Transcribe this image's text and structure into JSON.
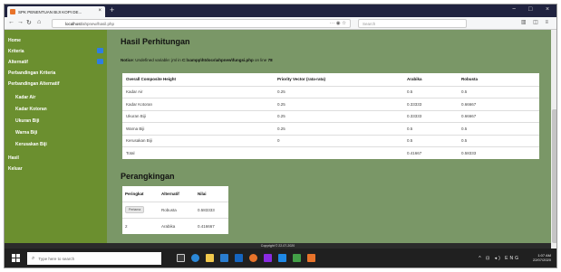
{
  "browser": {
    "tab_title": "SPK PENENTUAN BIJI KOPI DE...",
    "url_host": "localhost",
    "url_path": "/ahpnew/hasil.php",
    "search_placeholder": "Search",
    "url_extra": "··· ◉ ☆"
  },
  "sidebar": {
    "items": [
      {
        "label": "Home"
      },
      {
        "label": "Kriteria"
      },
      {
        "label": "Alternatif"
      },
      {
        "label": "Perbandingan Kriteria"
      },
      {
        "label": "Perbandingan Alternatif"
      },
      {
        "label": "Kadar Air"
      },
      {
        "label": "Kadar Kotoran"
      },
      {
        "label": "Ukuran Biji"
      },
      {
        "label": "Warna Biji"
      },
      {
        "label": "Kerusakan Biji"
      },
      {
        "label": "Hasil"
      },
      {
        "label": "Keluar"
      }
    ]
  },
  "main": {
    "title": "Hasil Perhitungan",
    "notice": {
      "label": "Notice",
      "text": ": Undefined variable: jml in ",
      "path": "C:\\xampp\\htdocs\\ahpnew\\fungsi.php",
      "line_text": " on line ",
      "line": "78"
    },
    "table": {
      "headers": [
        "Overall Composite Height",
        "Priority Vector (rata-rata)",
        "Arabika",
        "Robusta"
      ],
      "rows": [
        [
          "Kadar Air",
          "0.25",
          "0.5",
          "0.5"
        ],
        [
          "Kadar Kotoran",
          "0.25",
          "0.33333",
          "0.66667"
        ],
        [
          "Ukuran Biji",
          "0.25",
          "0.33333",
          "0.66667"
        ],
        [
          "Warna Biji",
          "0.25",
          "0.5",
          "0.5"
        ],
        [
          "Kerusakan Biji",
          "0",
          "0.5",
          "0.5"
        ],
        [
          "Total",
          "",
          "0.41667",
          "0.58333"
        ]
      ]
    },
    "ranking_title": "Perangkingan",
    "ranking": {
      "headers": [
        "Peringkat",
        "Alternatif",
        "Nilai"
      ],
      "rows": [
        [
          "Pertama",
          "Robusta",
          "0.583333"
        ],
        [
          "2",
          "Arabika",
          "0.416667"
        ]
      ]
    },
    "footer": "Copyright © 22-07-2020"
  },
  "taskbar": {
    "search_placeholder": "Type here to search",
    "time": "1:07 AM",
    "date": "22/07/2020",
    "tray": "^ ⊡ ◂) ENG"
  },
  "colors": {
    "sidebar": "#6b8f2f",
    "page_bg": "#7a9767",
    "badge": "#2f7de1",
    "tabbar": "#202340"
  }
}
